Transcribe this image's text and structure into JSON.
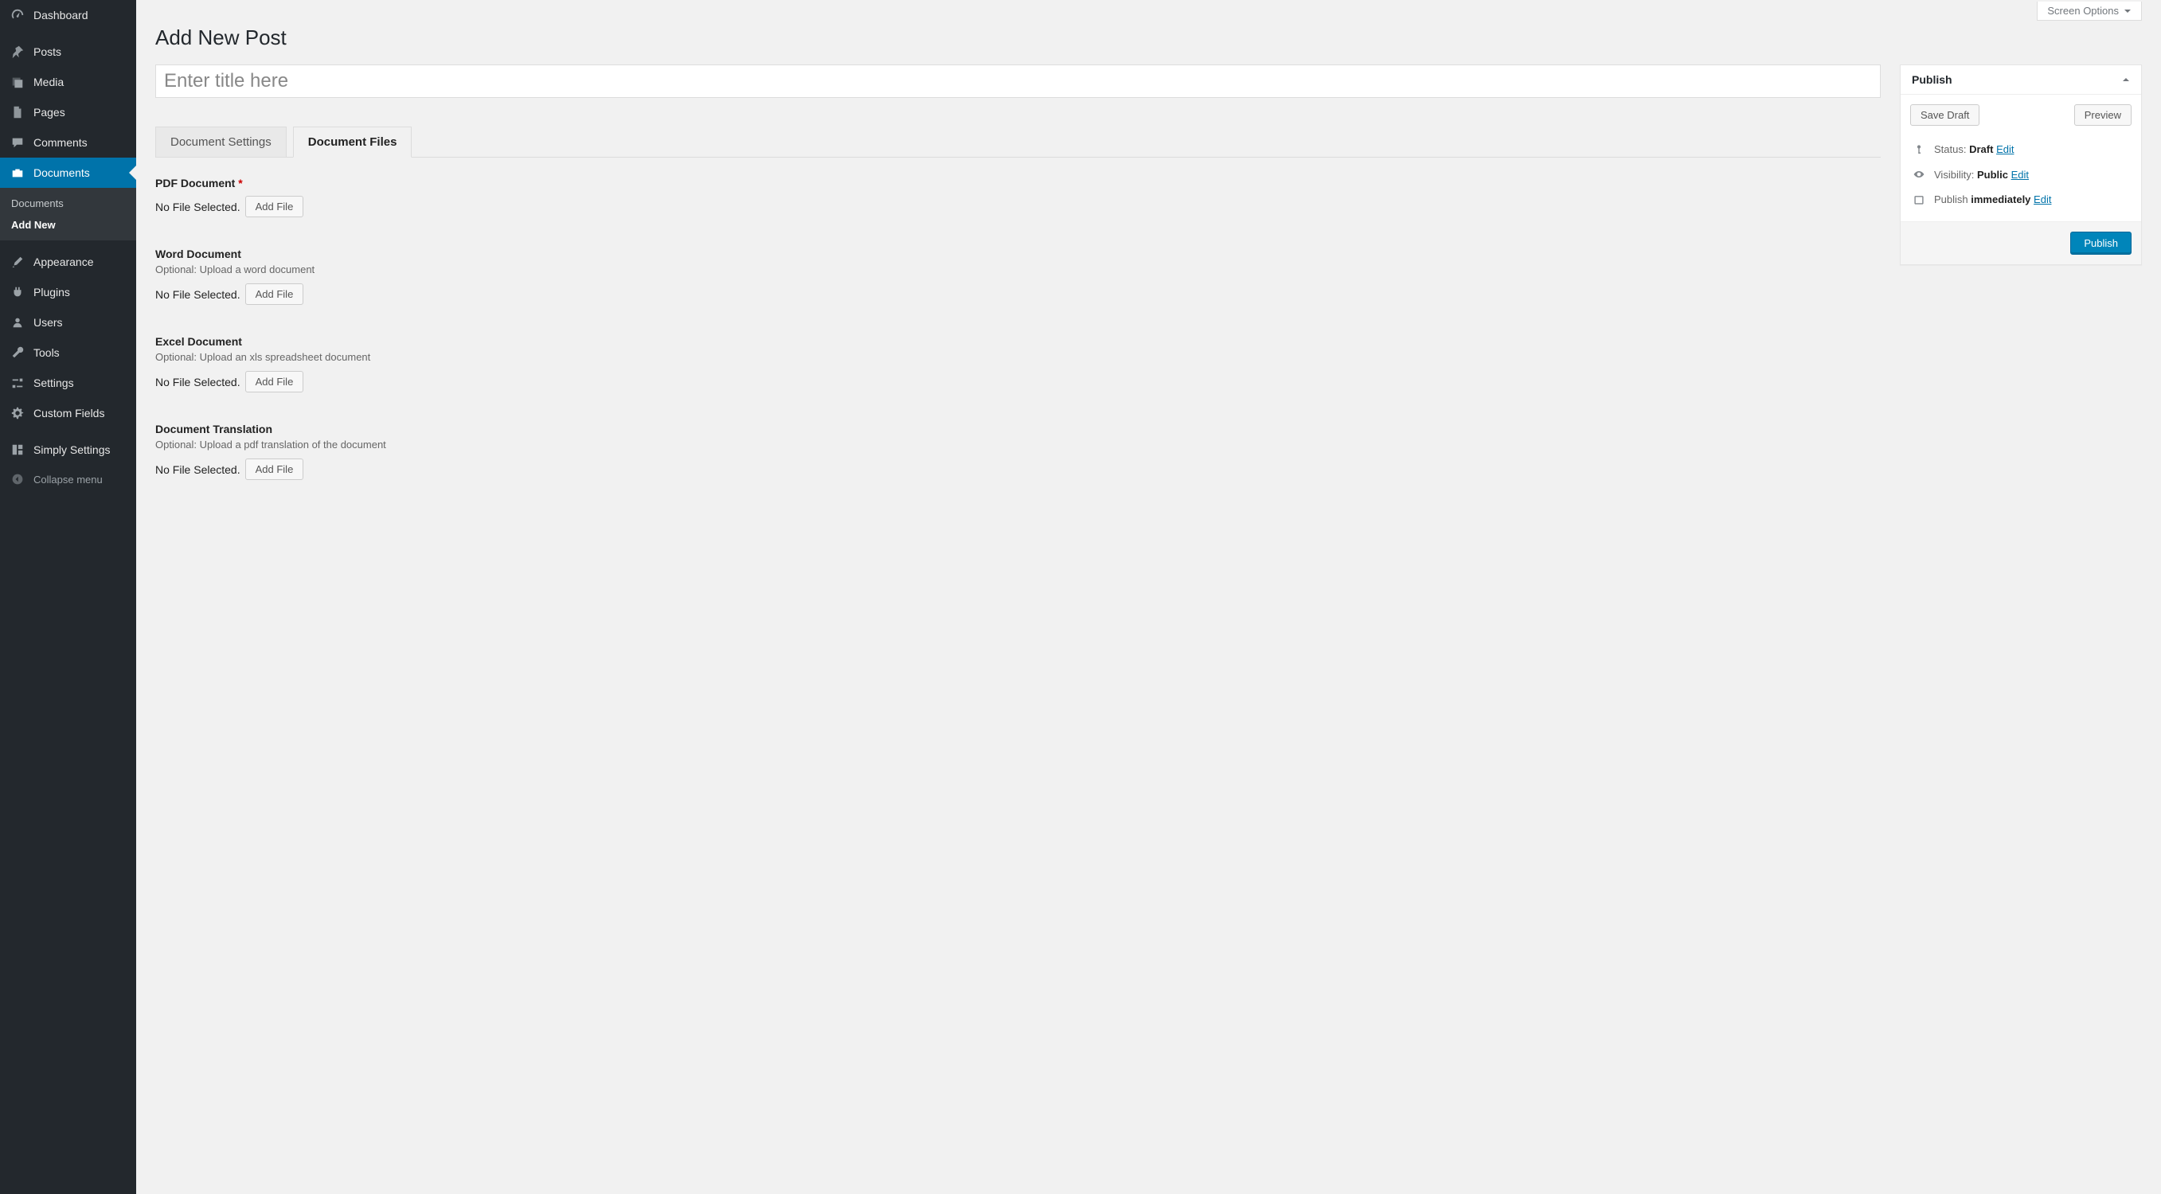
{
  "screen_options_label": "Screen Options",
  "page_title": "Add New Post",
  "title_placeholder": "Enter title here",
  "sidebar": {
    "dashboard": "Dashboard",
    "posts": "Posts",
    "media": "Media",
    "pages": "Pages",
    "comments": "Comments",
    "documents": "Documents",
    "documents_sub_all": "Documents",
    "documents_sub_add": "Add New",
    "appearance": "Appearance",
    "plugins": "Plugins",
    "users": "Users",
    "tools": "Tools",
    "settings": "Settings",
    "custom_fields": "Custom Fields",
    "simply_settings": "Simply Settings",
    "collapse": "Collapse menu"
  },
  "tabs": {
    "settings": "Document Settings",
    "files": "Document Files"
  },
  "fields": {
    "pdf": {
      "label": "PDF Document",
      "required": true,
      "state": "No File Selected.",
      "button": "Add File"
    },
    "word": {
      "label": "Word Document",
      "desc": "Optional: Upload a word document",
      "state": "No File Selected.",
      "button": "Add File"
    },
    "excel": {
      "label": "Excel Document",
      "desc": "Optional: Upload an xls spreadsheet document",
      "state": "No File Selected.",
      "button": "Add File"
    },
    "translation": {
      "label": "Document Translation",
      "desc": "Optional: Upload a pdf translation of the document",
      "state": "No File Selected.",
      "button": "Add File"
    }
  },
  "publish": {
    "box_title": "Publish",
    "save_draft": "Save Draft",
    "preview": "Preview",
    "status_label": "Status:",
    "status_value": "Draft",
    "visibility_label": "Visibility:",
    "visibility_value": "Public",
    "schedule_label": "Publish",
    "schedule_value": "immediately",
    "edit": "Edit",
    "publish_button": "Publish"
  }
}
